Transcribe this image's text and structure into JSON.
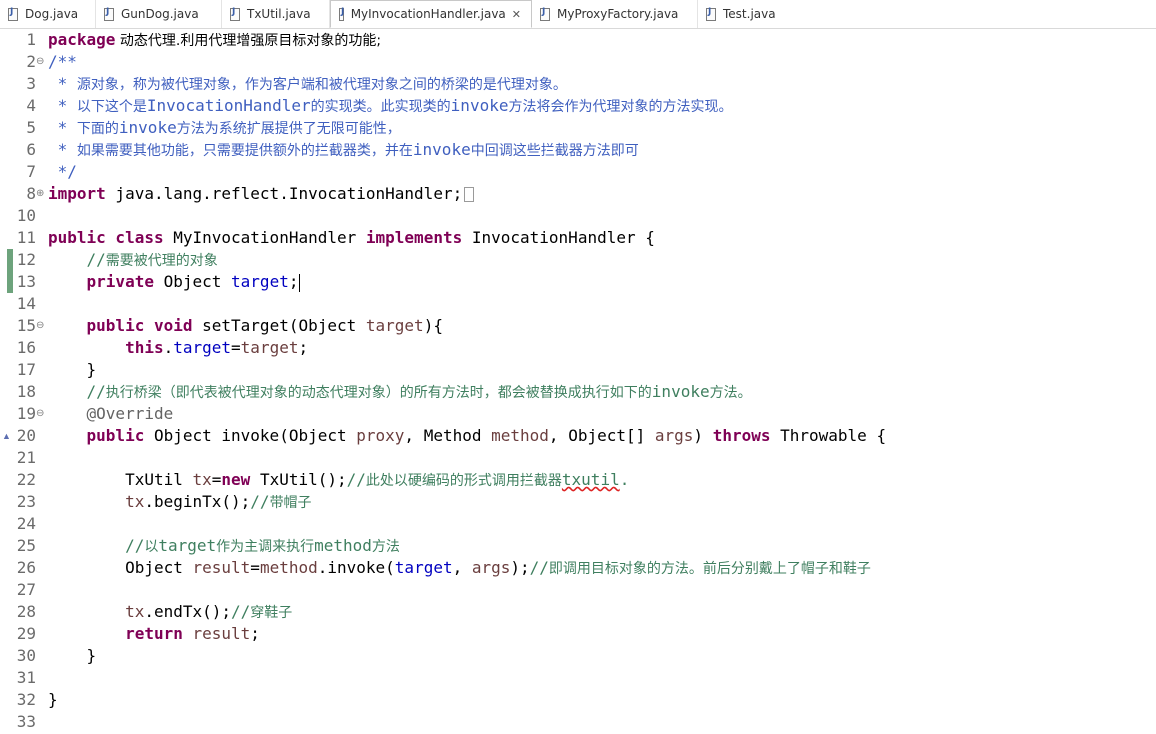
{
  "tabs": [
    {
      "label": "Dog.java",
      "active": false
    },
    {
      "label": "GunDog.java",
      "active": false
    },
    {
      "label": "TxUtil.java",
      "active": false
    },
    {
      "label": "MyInvocationHandler.java",
      "active": true
    },
    {
      "label": "MyProxyFactory.java",
      "active": false
    },
    {
      "label": "Test.java",
      "active": false
    }
  ],
  "editor": {
    "line_numbers": [
      "1",
      "2",
      "3",
      "4",
      "5",
      "6",
      "7",
      "8",
      "10",
      "11",
      "12",
      "13",
      "14",
      "15",
      "16",
      "17",
      "18",
      "19",
      "20",
      "21",
      "22",
      "23",
      "24",
      "25",
      "26",
      "27",
      "28",
      "29",
      "30",
      "31",
      "32",
      "33"
    ],
    "t": {
      "l1_kw": "package",
      "l1_pkg": " 动态代理.利用代理增强原目标对象的功能;",
      "l2": "/**",
      "l3a": " * ",
      "l3b": "源对象，称为被代理对象，作为客户端和被代理对象之间的桥梁的是代理对象。",
      "l4a": " * ",
      "l4b": "以下这个是",
      "l4c": "InvocationHandler",
      "l4d": "的实现类。此实现类的",
      "l4e": "invoke",
      "l4f": "方法将会作为代理对象的方法实现。",
      "l5a": " * ",
      "l5b": "下面的",
      "l5c": "invoke",
      "l5d": "方法为系统扩展提供了无限可能性，",
      "l6a": " * ",
      "l6b": "如果需要其他功能，只需要提供额外的拦截器类，并在",
      "l6c": "invoke",
      "l6d": "中回调这些拦截器方法即可",
      "l7": " */",
      "l8_kw": "import",
      "l8_rest": " java.lang.reflect.InvocationHandler;",
      "l11_kw1": "public class",
      "l11_name": " MyInvocationHandler ",
      "l11_kw2": "implements",
      "l11_rest": " InvocationHandler {",
      "l12_indent": "    ",
      "l12_c1": "//",
      "l12_c2": "需要被代理的对象",
      "l13_indent": "    ",
      "l13_kw": "private",
      "l13_type": " Object ",
      "l13_fld": "target",
      "l13_end": ";",
      "l15_indent": "    ",
      "l15_kw": "public void",
      "l15_rest1": " setTarget(Object ",
      "l15_var": "target",
      "l15_rest2": "){",
      "l16_indent": "        ",
      "l16_kw": "this",
      "l16_dot": ".",
      "l16_fld": "target",
      "l16_eq": "=",
      "l16_var": "target",
      "l16_end": ";",
      "l17": "    }",
      "l18_indent": "    ",
      "l18_c1": "//",
      "l18_c2": "执行桥梁（即代表被代理对象的动态代理对象）的所有方法时，都会被替换成执行如下的",
      "l18_c3": "invoke",
      "l18_c4": "方法。",
      "l19_indent": "    ",
      "l19_ann": "@Override",
      "l20_indent": "    ",
      "l20_kw": "public",
      "l20_r1": " Object invoke(Object ",
      "l20_v1": "proxy",
      "l20_r2": ", Method ",
      "l20_v2": "method",
      "l20_r3": ", Object[] ",
      "l20_v3": "args",
      "l20_r4": ") ",
      "l20_kw2": "throws",
      "l20_r5": " Throwable {",
      "l22_indent": "        ",
      "l22_r1": "TxUtil ",
      "l22_v1": "tx",
      "l22_eq": "=",
      "l22_kw": "new",
      "l22_r2": " TxUtil();",
      "l22_c1": "//",
      "l22_c2": "此处以硬编码的形式调用拦截器",
      "l22_c3": "txutil",
      "l22_c4": ".",
      "l23_indent": "        ",
      "l23_v": "tx",
      "l23_r": ".beginTx();",
      "l23_c1": "//",
      "l23_c2": "带帽子",
      "l25_indent": "        ",
      "l25_c1": "//",
      "l25_c2": "以",
      "l25_c3": "target",
      "l25_c4": "作为主调来执行",
      "l25_c5": "method",
      "l25_c6": "方法",
      "l26_indent": "        ",
      "l26_r1": "Object ",
      "l26_v1": "result",
      "l26_eq": "=",
      "l26_v2": "method",
      "l26_r2": ".invoke(",
      "l26_f": "target",
      "l26_r3": ", ",
      "l26_v3": "args",
      "l26_r4": ");",
      "l26_c1": "//",
      "l26_c2": "即调用目标对象的方法。前后分别戴上了帽子和鞋子",
      "l28_indent": "        ",
      "l28_v": "tx",
      "l28_r": ".endTx();",
      "l28_c1": "//",
      "l28_c2": "穿鞋子",
      "l29_indent": "        ",
      "l29_kw": "return",
      "l29_r": " ",
      "l29_v": "result",
      "l29_end": ";",
      "l30": "    }",
      "l32": "}"
    }
  }
}
